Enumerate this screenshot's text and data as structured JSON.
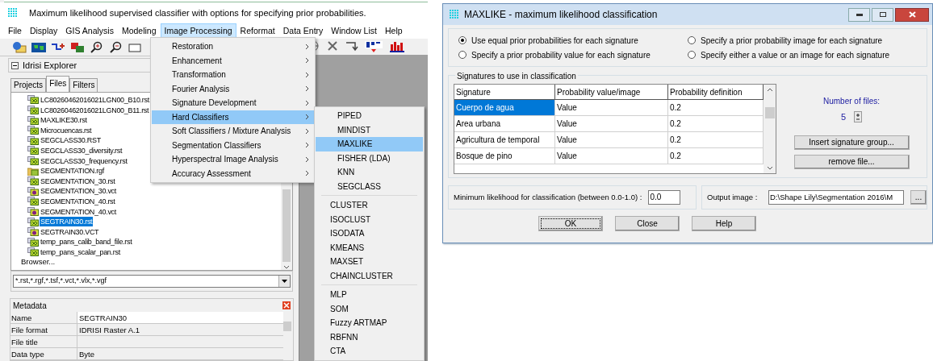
{
  "app": {
    "title": "Maximum likelihood supervised classifier with options for specifying prior probabilities.",
    "menu": [
      {
        "label": "File",
        "selected": false
      },
      {
        "label": "Display",
        "selected": false
      },
      {
        "label": "GIS Analysis",
        "selected": false
      },
      {
        "label": "Modeling",
        "selected": false
      },
      {
        "label": "Image Processing",
        "selected": true
      },
      {
        "label": "Reformat",
        "selected": false
      },
      {
        "label": "Data Entry",
        "selected": false
      },
      {
        "label": "Window List",
        "selected": false
      },
      {
        "label": "Help",
        "selected": false
      }
    ],
    "explorer": {
      "title": "Idrisi Explorer",
      "tabs": [
        {
          "label": "Projects",
          "selected": false
        },
        {
          "label": "Files",
          "selected": true
        },
        {
          "label": "Filters",
          "selected": false
        }
      ],
      "files": [
        {
          "name": "LC80260462016021LGN00_B10.rst",
          "kind": "raster",
          "selected": false
        },
        {
          "name": "LC80260462016021LGN00_B11.rst",
          "kind": "raster",
          "selected": false
        },
        {
          "name": "MAXLIKE30.rst",
          "kind": "raster",
          "selected": false
        },
        {
          "name": "Microcuencas.rst",
          "kind": "raster",
          "selected": false
        },
        {
          "name": "SEGCLASS30.RST",
          "kind": "raster",
          "selected": false
        },
        {
          "name": "SEGCLASS30_diversity.rst",
          "kind": "raster",
          "selected": false
        },
        {
          "name": "SEGCLASS30_frequency.rst",
          "kind": "raster",
          "selected": false
        },
        {
          "name": "SEGMENTATION.rgf",
          "kind": "group",
          "selected": false
        },
        {
          "name": "SEGMENTATION_30.rst",
          "kind": "raster",
          "selected": false
        },
        {
          "name": "SEGMENTATION_30.vct",
          "kind": "vector",
          "selected": false
        },
        {
          "name": "SEGMENTATION_40.rst",
          "kind": "raster",
          "selected": false
        },
        {
          "name": "SEGMENTATION_40.vct",
          "kind": "vector",
          "selected": false
        },
        {
          "name": "SEGTRAIN30.rst",
          "kind": "raster",
          "selected": true
        },
        {
          "name": "SEGTRAIN30.VCT",
          "kind": "vector",
          "selected": false
        },
        {
          "name": "temp_pans_calib_band_file.rst",
          "kind": "raster",
          "selected": false
        },
        {
          "name": "temp_pans_scalar_pan.rst",
          "kind": "raster",
          "selected": false
        }
      ],
      "browse": "Browser...",
      "filter": "*.rst,*.rgf,*.tsf,*.vct,*.vlx,*.vgf",
      "metadata": {
        "title": "Metadata",
        "rows": [
          {
            "key": "Name",
            "value": "SEGTRAIN30"
          },
          {
            "key": "File format",
            "value": "IDRISI Raster A.1"
          },
          {
            "key": "File title",
            "value": ""
          },
          {
            "key": "Data type",
            "value": "Byte"
          }
        ]
      }
    },
    "dropdown": [
      {
        "label": "Restoration",
        "selected": false
      },
      {
        "label": "Enhancement",
        "selected": false
      },
      {
        "label": "Transformation",
        "selected": false
      },
      {
        "label": "Fourier Analysis",
        "selected": false
      },
      {
        "label": "Signature Development",
        "selected": false
      },
      {
        "label": "Hard Classifiers",
        "selected": true
      },
      {
        "label": "Soft Classifiers / Mixture Analysis",
        "selected": false
      },
      {
        "label": "Segmentation Classifiers",
        "selected": false
      },
      {
        "label": "Hyperspectral Image Analysis",
        "selected": false
      },
      {
        "label": "Accuracy Assessment",
        "selected": false
      }
    ],
    "submenu": [
      [
        {
          "label": "PIPED",
          "selected": false
        },
        {
          "label": "MINDIST",
          "selected": false
        },
        {
          "label": "MAXLIKE",
          "selected": true
        },
        {
          "label": "FISHER (LDA)",
          "selected": false
        },
        {
          "label": "KNN",
          "selected": false
        },
        {
          "label": "SEGCLASS",
          "selected": false
        }
      ],
      [
        {
          "label": "CLUSTER",
          "selected": false
        },
        {
          "label": "ISOCLUST",
          "selected": false
        },
        {
          "label": "ISODATA",
          "selected": false
        },
        {
          "label": "KMEANS",
          "selected": false
        },
        {
          "label": "MAXSET",
          "selected": false
        },
        {
          "label": "CHAINCLUSTER",
          "selected": false
        }
      ],
      [
        {
          "label": "MLP",
          "selected": false
        },
        {
          "label": "SOM",
          "selected": false
        },
        {
          "label": "Fuzzy ARTMAP",
          "selected": false
        },
        {
          "label": "RBFNN",
          "selected": false
        },
        {
          "label": "CTA",
          "selected": false
        }
      ]
    ]
  },
  "dialog": {
    "title": "MAXLIKE - maximum likelihood classification",
    "radios": [
      {
        "label": "Use equal prior probabilities for each signature",
        "selected": true
      },
      {
        "label": "Specify a prior probability image for each signature",
        "selected": false
      },
      {
        "label": "Specify a prior probability value for each signature",
        "selected": false
      },
      {
        "label": "Specify either a value or an image for each signature",
        "selected": false
      }
    ],
    "group_title": "Signatures to use in classification",
    "columns": [
      "Signature",
      "Probability value/image",
      "Probability definition"
    ],
    "rows": [
      {
        "cells": [
          "Cuerpo de agua",
          "Value",
          "0.2"
        ],
        "selected": true
      },
      {
        "cells": [
          "Area urbana",
          "Value",
          "0.2"
        ],
        "selected": false
      },
      {
        "cells": [
          "Agricultura de temporal",
          "Value",
          "0.2"
        ],
        "selected": false
      },
      {
        "cells": [
          "Bosque de pino",
          "Value",
          "0.2"
        ],
        "selected": false
      }
    ],
    "files_label": "Number of files:",
    "files_count": "5",
    "side_buttons": [
      "Insert signature group...",
      "remove file..."
    ],
    "min_label": "Minimum likelihood for classification (between 0.0-1.0) :",
    "min_value": "0.0",
    "output_label": "Output image :",
    "output_value": "D:\\Shape Lily\\Segmentation 2016\\M",
    "browse_button": "...",
    "buttons": [
      "OK",
      "Close",
      "Help"
    ]
  }
}
